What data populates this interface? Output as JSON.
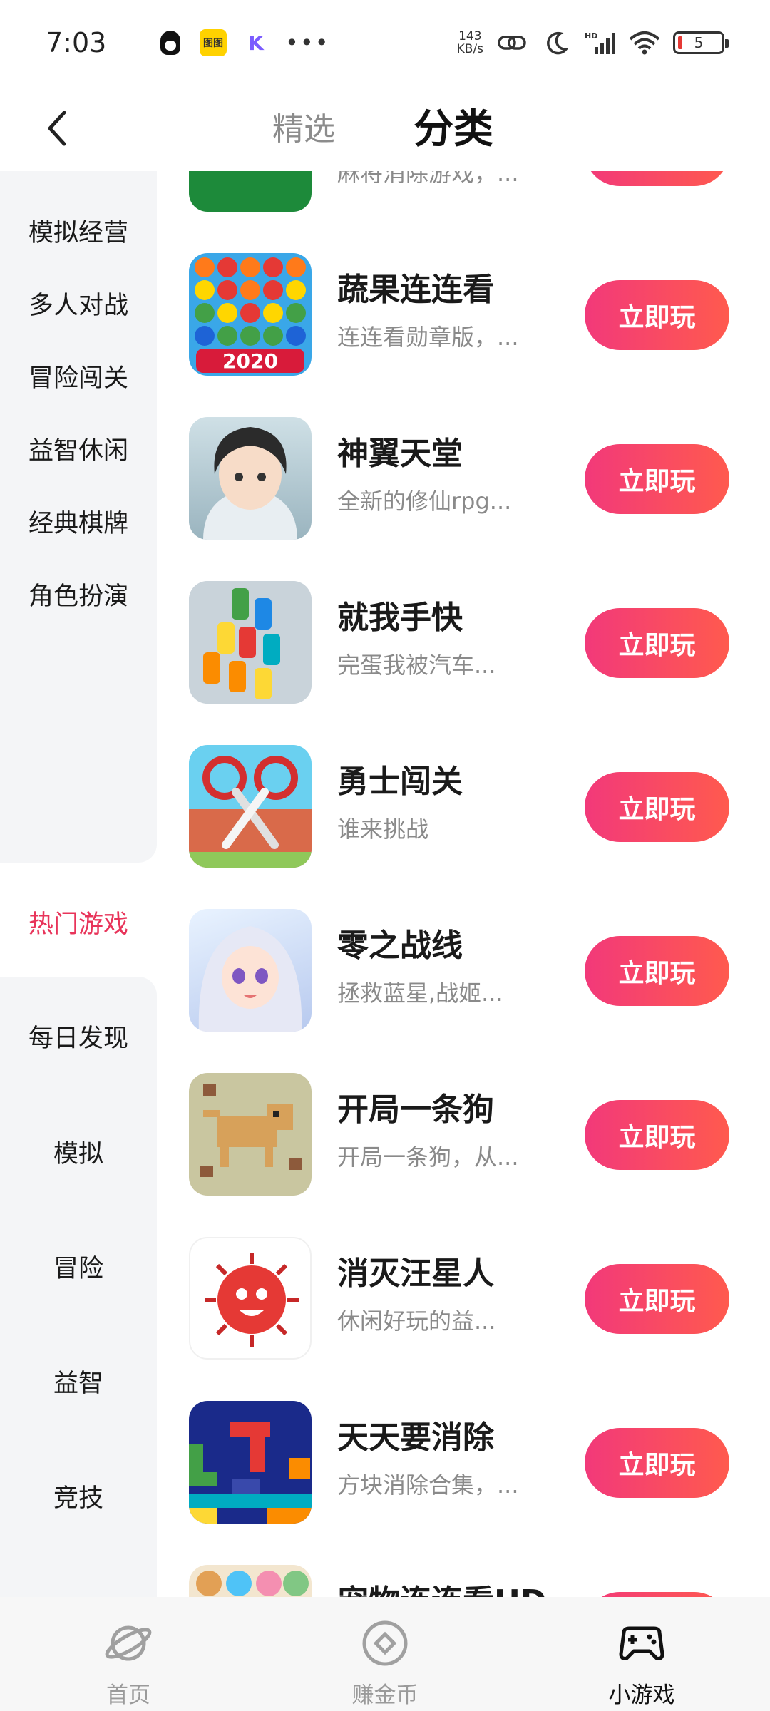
{
  "status_bar": {
    "time": "7:03",
    "net_speed_value": "143",
    "net_speed_unit": "KB/s",
    "battery": "5",
    "yellow_app_text": "图图"
  },
  "header": {
    "tab_featured": "精选",
    "tab_category": "分类"
  },
  "sidebar": {
    "items": [
      {
        "label": "模拟经营"
      },
      {
        "label": "多人对战"
      },
      {
        "label": "冒险闯关"
      },
      {
        "label": "益智休闲"
      },
      {
        "label": "经典棋牌"
      },
      {
        "label": "角色扮演"
      },
      {
        "label": "热门游戏"
      },
      {
        "label": "每日发现"
      },
      {
        "label": "模拟"
      },
      {
        "label": "冒险"
      },
      {
        "label": "益智"
      },
      {
        "label": "竞技"
      }
    ],
    "active_index": 6
  },
  "games": [
    {
      "title": "",
      "desc": "麻将消除游戏，...",
      "icon": "mahjong-icon"
    },
    {
      "title": "蔬果连连看",
      "desc": "连连看勋章版，...",
      "icon": "fruit-match-icon"
    },
    {
      "title": "神翼天堂",
      "desc": "全新的修仙rpg...",
      "icon": "xianxia-hero-icon"
    },
    {
      "title": "就我手快",
      "desc": "完蛋我被汽车...",
      "icon": "parking-cars-icon"
    },
    {
      "title": "勇士闯关",
      "desc": "谁来挑战",
      "icon": "scissors-icon"
    },
    {
      "title": "零之战线",
      "desc": "拯救蓝星,战姬...",
      "icon": "anime-girl-icon"
    },
    {
      "title": "开局一条狗",
      "desc": "开局一条狗，从...",
      "icon": "pixel-dog-icon"
    },
    {
      "title": "消灭汪星人",
      "desc": "休闲好玩的益...",
      "icon": "virus-icon"
    },
    {
      "title": "天天要消除",
      "desc": "方块消除合集，...",
      "icon": "block-puzzle-icon"
    },
    {
      "title": "宠物连连看HD",
      "desc": "",
      "icon": "pet-match-icon"
    }
  ],
  "play_label": "立即玩",
  "fruit_icon_badge": "2020",
  "bottom_nav": {
    "home": "首页",
    "earn": "赚金币",
    "games": "小游戏"
  },
  "colors": {
    "accent": "#e8345a",
    "button_start": "#f2397a",
    "button_end": "#ff5a4e",
    "sidebar_bg": "#f4f5f7"
  }
}
